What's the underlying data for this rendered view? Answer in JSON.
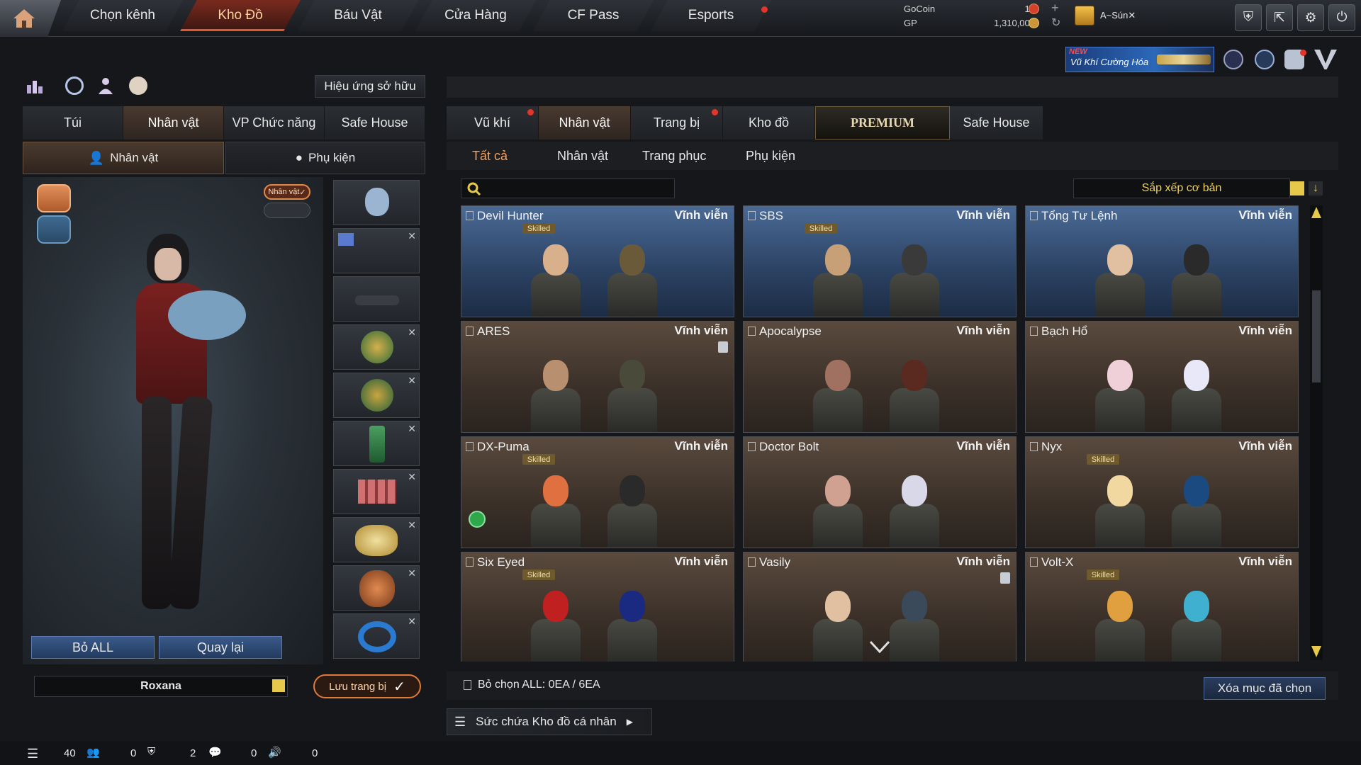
{
  "nav": {
    "tabs": [
      "Chọn kênh",
      "Kho Đồ",
      "Báu Vật",
      "Cửa Hàng",
      "CF Pass",
      "Esports"
    ],
    "active": "Kho Đồ"
  },
  "currency": {
    "gocoin_label": "GoCoin",
    "gocoin_value": "19",
    "gp_label": "GP",
    "gp_value": "1,310,005"
  },
  "user": {
    "name": "A~Sún✕"
  },
  "promo": {
    "badge": "NEW",
    "text": "Vũ Khí Cường Hóa"
  },
  "left": {
    "owned_effects_label": "Hiệu ứng sở hữu",
    "tabs": [
      "Túi",
      "Nhân vật",
      "VP Chức năng",
      "Safe House"
    ],
    "active_tab": "Nhân vật",
    "subtabs": [
      "Nhân vật",
      "Phụ kiện"
    ],
    "char_toggle": "Nhân vật",
    "remove_all": "Bỏ ALL",
    "back": "Quay lại",
    "character_name": "Roxana",
    "save_gear": "Lưu trang bị"
  },
  "right": {
    "tabs": [
      "Vũ khí",
      "Nhân vật",
      "Trang bị",
      "Kho đồ",
      "PREMIUM",
      "Safe House"
    ],
    "active_tab": "Nhân vật",
    "subtabs": [
      "Tất cả",
      "Nhân vật",
      "Trang phục",
      "Phụ kiện"
    ],
    "active_subtab": "Tất cả",
    "search_placeholder": "",
    "sort_label": "Sắp xếp cơ bản",
    "cards": [
      {
        "name": "Devil Hunter",
        "duration": "Vĩnh viễn",
        "skilled": "Skilled",
        "theme": "blue"
      },
      {
        "name": "SBS",
        "duration": "Vĩnh viễn",
        "skilled": "Skilled",
        "theme": "blue"
      },
      {
        "name": "Tổng Tư Lệnh",
        "duration": "Vĩnh viễn",
        "skilled": "",
        "theme": "blue"
      },
      {
        "name": "ARES",
        "duration": "Vĩnh viễn",
        "skilled": "",
        "theme": "brown"
      },
      {
        "name": "Apocalypse",
        "duration": "Vĩnh viễn",
        "skilled": "",
        "theme": "brown"
      },
      {
        "name": "Bạch Hổ",
        "duration": "Vĩnh viễn",
        "skilled": "",
        "theme": "brown"
      },
      {
        "name": "DX-Puma",
        "duration": "Vĩnh viễn",
        "skilled": "Skilled",
        "theme": "brown"
      },
      {
        "name": "Doctor Bolt",
        "duration": "Vĩnh viễn",
        "skilled": "",
        "theme": "brown"
      },
      {
        "name": "Nyx",
        "duration": "Vĩnh viễn",
        "skilled": "Skilled",
        "theme": "brown"
      },
      {
        "name": "Six Eyed",
        "duration": "Vĩnh viễn",
        "skilled": "Skilled",
        "theme": "brown"
      },
      {
        "name": "Vasily",
        "duration": "Vĩnh viễn",
        "skilled": "",
        "theme": "brown"
      },
      {
        "name": "Volt-X",
        "duration": "Vĩnh viễn",
        "skilled": "Skilled",
        "theme": "brown"
      }
    ],
    "deselect_label": "Bỏ chọn ALL: 0EA / 6EA",
    "delete_selected": "Xóa mục đã chọn",
    "capacity_label": "Sức chứa Kho đồ cá nhân"
  },
  "statusbar": {
    "friends": "40",
    "clan": "0",
    "chat": "2",
    "voice": "0",
    "extra": "0"
  }
}
